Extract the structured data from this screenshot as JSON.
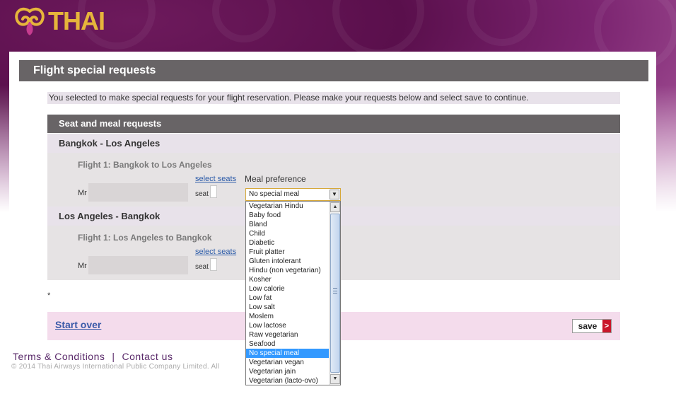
{
  "brand": {
    "name": "THAI",
    "accent": "#e6b53b",
    "primary": "#5a0f4c"
  },
  "page": {
    "title": "Flight special requests",
    "intro": "You selected to make special requests for your flight reservation. Please make your requests below and select save to continue."
  },
  "section": {
    "title": "Seat and meal requests",
    "meal_label": "Meal preference",
    "routes": [
      {
        "route": "Bangkok - Los Angeles",
        "flight": "Flight 1: Bangkok to Los Angeles",
        "select_seats": "select seats",
        "title": "Mr",
        "seat_label": "seat"
      },
      {
        "route": "Los Angeles - Bangkok",
        "flight": "Flight 1: Los Angeles to Bangkok",
        "select_seats": "select seats",
        "title": "Mr",
        "seat_label": "seat"
      }
    ]
  },
  "meal_select": {
    "value": "No special meal",
    "options": [
      "Vegetarian Hindu",
      "Baby food",
      "Bland",
      "Child",
      "Diabetic",
      "Fruit platter",
      "Gluten intolerant",
      "Hindu (non vegetarian)",
      "Kosher",
      "Low calorie",
      "Low fat",
      "Low salt",
      "Moslem",
      "Low lactose",
      "Raw vegetarian",
      "Seafood",
      "No special meal",
      "Vegetarian vegan",
      "Vegetarian jain",
      "Vegetarian (lacto-ovo)"
    ],
    "selected_index": 16
  },
  "footnote": "*",
  "actions": {
    "start_over": "Start over",
    "save": "save",
    "save_arrow": ">"
  },
  "footer": {
    "terms": "Terms & Conditions",
    "separator": "|",
    "contact": "Contact us",
    "copyright": "© 2014 Thai Airways International Public Company Limited. All"
  },
  "icons": {
    "logo": "thai-orchid-logo-icon",
    "dropdown": "chevron-down-icon",
    "scroll_up": "scroll-up-icon",
    "scroll_down": "scroll-down-icon",
    "save_arrow": "arrow-right-icon"
  }
}
